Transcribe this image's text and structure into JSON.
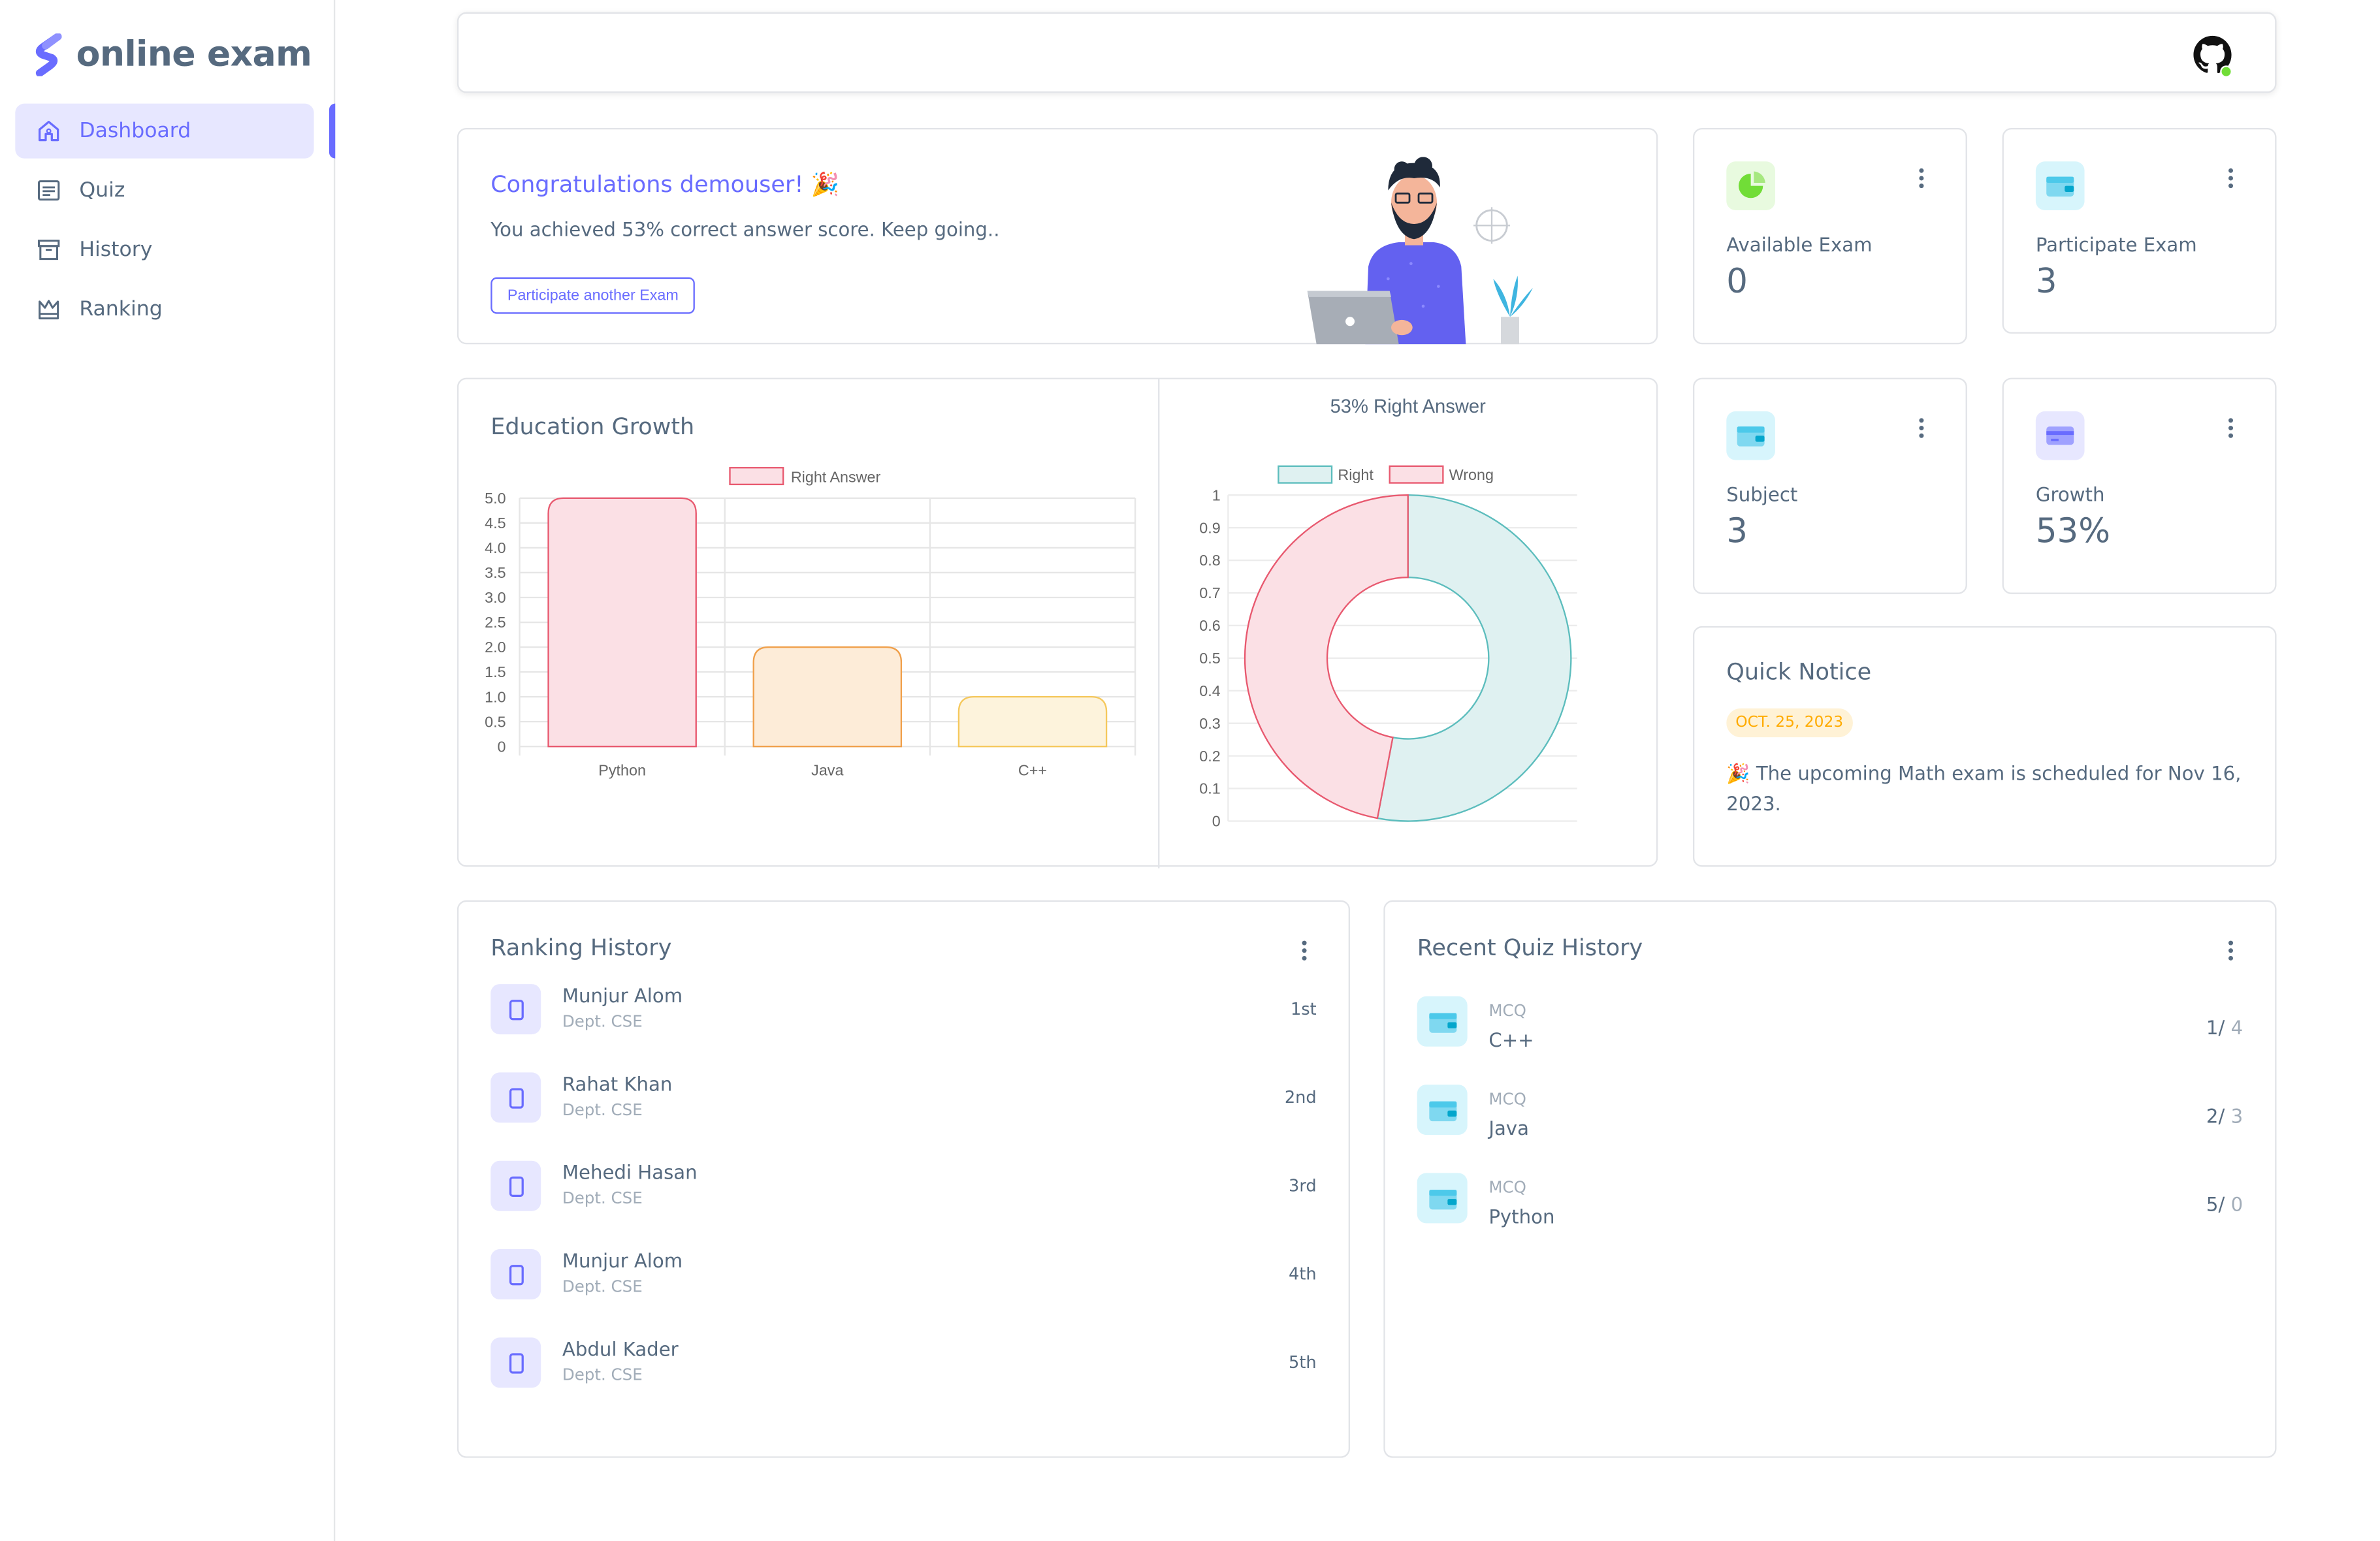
{
  "brand": {
    "name": "online exam"
  },
  "sidebar": {
    "items": [
      {
        "label": "Dashboard",
        "icon": "home-icon",
        "active": true
      },
      {
        "label": "Quiz",
        "icon": "quiz-icon"
      },
      {
        "label": "History",
        "icon": "history-icon"
      },
      {
        "label": "Ranking",
        "icon": "ranking-icon"
      }
    ]
  },
  "topbar": {
    "profile_icon": "github-icon",
    "status_color": "#71dd37"
  },
  "congrats": {
    "title": "Congratulations demouser! 🎉",
    "message": "You achieved 53% correct answer score. Keep going..",
    "button_label": "Participate another Exam"
  },
  "stats": [
    {
      "label": "Available Exam",
      "value": "0",
      "icon": "chart-pie-icon",
      "color": "#71dd37"
    },
    {
      "label": "Participate Exam",
      "value": "3",
      "icon": "wallet-icon",
      "color": "#03c3ec"
    },
    {
      "label": "Subject",
      "value": "3",
      "icon": "wallet-icon",
      "color": "#03c3ec"
    },
    {
      "label": "Growth",
      "value": "53%",
      "icon": "credit-card-icon",
      "color": "#696cff"
    }
  ],
  "growth": {
    "title": "Education Growth"
  },
  "notice": {
    "title": "Quick Notice",
    "date": "OCT. 25, 2023",
    "text": "🎉 The upcoming Math exam is scheduled for Nov 16, 2023."
  },
  "ranking": {
    "title": "Ranking History",
    "rows": [
      {
        "name": "Munjur Alom",
        "dept": "Dept. CSE",
        "rank": "1st"
      },
      {
        "name": "Rahat Khan",
        "dept": "Dept. CSE",
        "rank": "2nd"
      },
      {
        "name": "Mehedi Hasan",
        "dept": "Dept. CSE",
        "rank": "3rd"
      },
      {
        "name": "Munjur Alom",
        "dept": "Dept. CSE",
        "rank": "4th"
      },
      {
        "name": "Abdul Kader",
        "dept": "Dept. CSE",
        "rank": "5th"
      }
    ]
  },
  "quiz_history": {
    "title": "Recent Quiz History",
    "rows": [
      {
        "type": "MCQ",
        "subject": "C++",
        "right": "1/",
        "total": " 4"
      },
      {
        "type": "MCQ",
        "subject": "Java",
        "right": "2/",
        "total": " 3"
      },
      {
        "type": "MCQ",
        "subject": "Python",
        "right": "5/",
        "total": " 0"
      }
    ]
  },
  "chart_data": [
    {
      "type": "bar",
      "legend": [
        "Right Answer"
      ],
      "categories": [
        "Python",
        "Java",
        "C++"
      ],
      "series": [
        {
          "name": "Right Answer",
          "values": [
            5,
            2,
            1
          ]
        }
      ],
      "colors": {
        "fill": [
          "#fbe0e5",
          "#fdecd8",
          "#fdf3dc"
        ],
        "stroke": [
          "#e8596f",
          "#f0a04b",
          "#f5c85c"
        ]
      },
      "ylim": [
        0,
        5
      ],
      "yticks": [
        "0",
        "0.5",
        "1.0",
        "1.5",
        "2.0",
        "2.5",
        "3.0",
        "3.5",
        "4.0",
        "4.5",
        "5.0"
      ],
      "grid": true,
      "legend_position": "top"
    },
    {
      "type": "pie",
      "title": "53% Right Answer",
      "labels": [
        "Right",
        "Wrong"
      ],
      "values": [
        0.53,
        0.47
      ],
      "colors": {
        "fill": [
          "#dff1f1",
          "#fbe0e5"
        ],
        "stroke": [
          "#5cbdbd",
          "#e8596f"
        ]
      },
      "ylim": [
        0,
        1
      ],
      "yticks": [
        "0",
        "0.1",
        "0.2",
        "0.3",
        "0.4",
        "0.5",
        "0.6",
        "0.7",
        "0.8",
        "0.9",
        "1"
      ],
      "grid": true,
      "legend_position": "top"
    }
  ]
}
